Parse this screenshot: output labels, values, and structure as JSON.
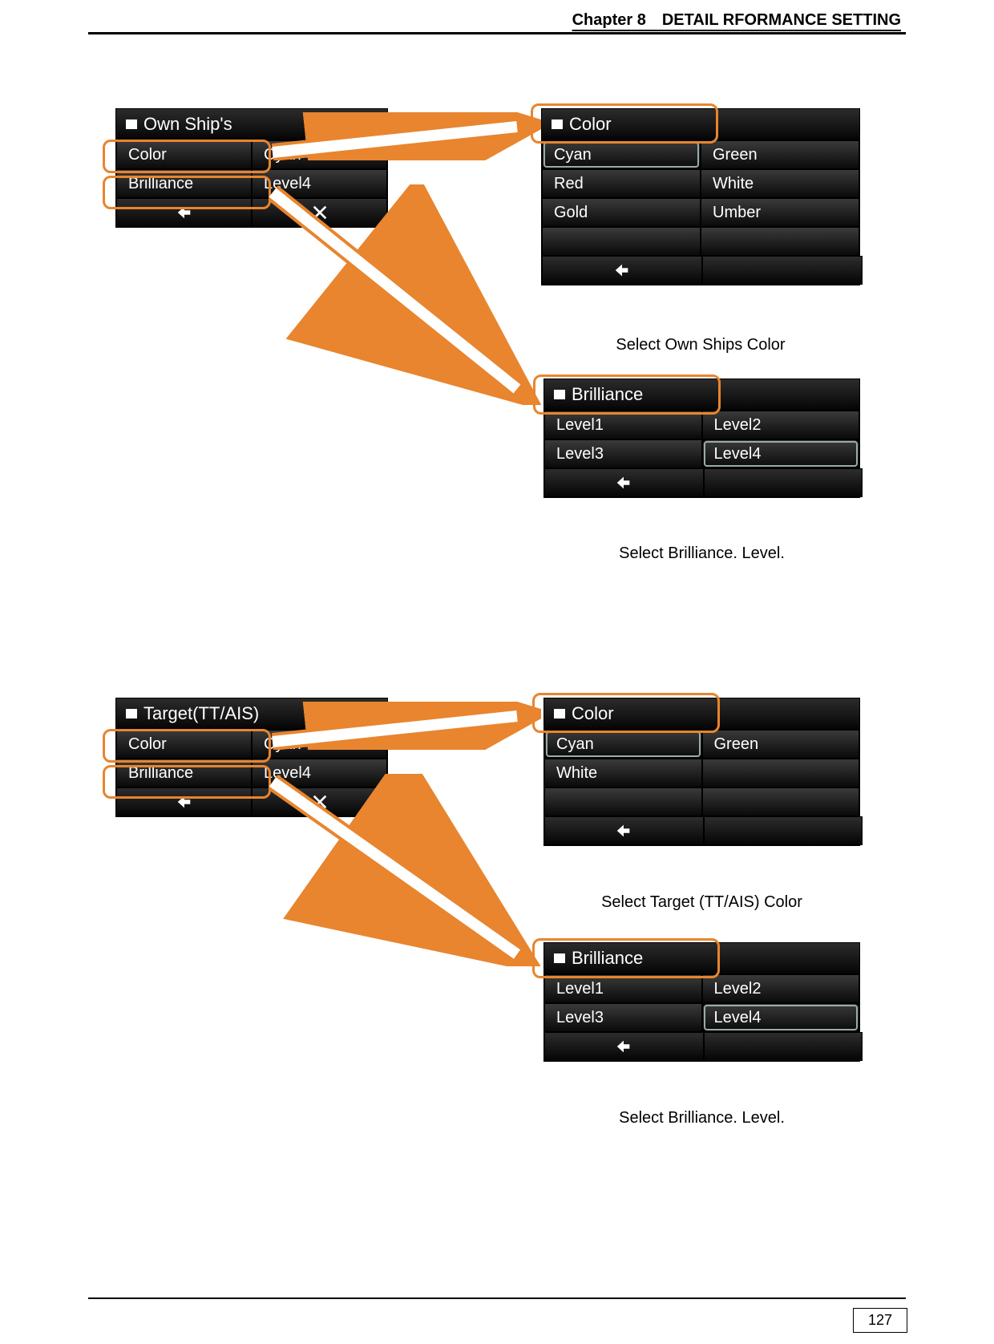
{
  "header": {
    "chapter": "Chapter 8 DETAIL RFORMANCE SETTING"
  },
  "footer": {
    "page": "127"
  },
  "panels": {
    "ownShip": {
      "title": "Own Ship's",
      "rows": [
        {
          "label": "Color",
          "value": "Cyan"
        },
        {
          "label": "Brilliance",
          "value": "Level4"
        }
      ]
    },
    "ownShipColor": {
      "title": "Color",
      "options": [
        [
          "Cyan",
          "Green"
        ],
        [
          "Red",
          "White"
        ],
        [
          "Gold",
          "Umber"
        ]
      ],
      "selected": "Cyan",
      "caption": "Select Own Ships Color"
    },
    "ownShipBrilliance": {
      "title": "Brilliance",
      "options": [
        [
          "Level1",
          "Level2"
        ],
        [
          "Level3",
          "Level4"
        ]
      ],
      "selected": "Level4",
      "caption": "Select Brilliance. Level."
    },
    "target": {
      "title": "Target(TT/AIS)",
      "rows": [
        {
          "label": "Color",
          "value": "Cyan"
        },
        {
          "label": "Brilliance",
          "value": "Level4"
        }
      ]
    },
    "targetColor": {
      "title": "Color",
      "options": [
        [
          "Cyan",
          "Green"
        ],
        [
          "White",
          ""
        ]
      ],
      "selected": "Cyan",
      "caption": "Select Target (TT/AIS) Color"
    },
    "targetBrilliance": {
      "title": "Brilliance",
      "options": [
        [
          "Level1",
          "Level2"
        ],
        [
          "Level3",
          "Level4"
        ]
      ],
      "selected": "Level4",
      "caption": "Select Brilliance. Level."
    }
  },
  "icons": {
    "back": "back-arrow-icon",
    "close": "close-x-icon"
  }
}
